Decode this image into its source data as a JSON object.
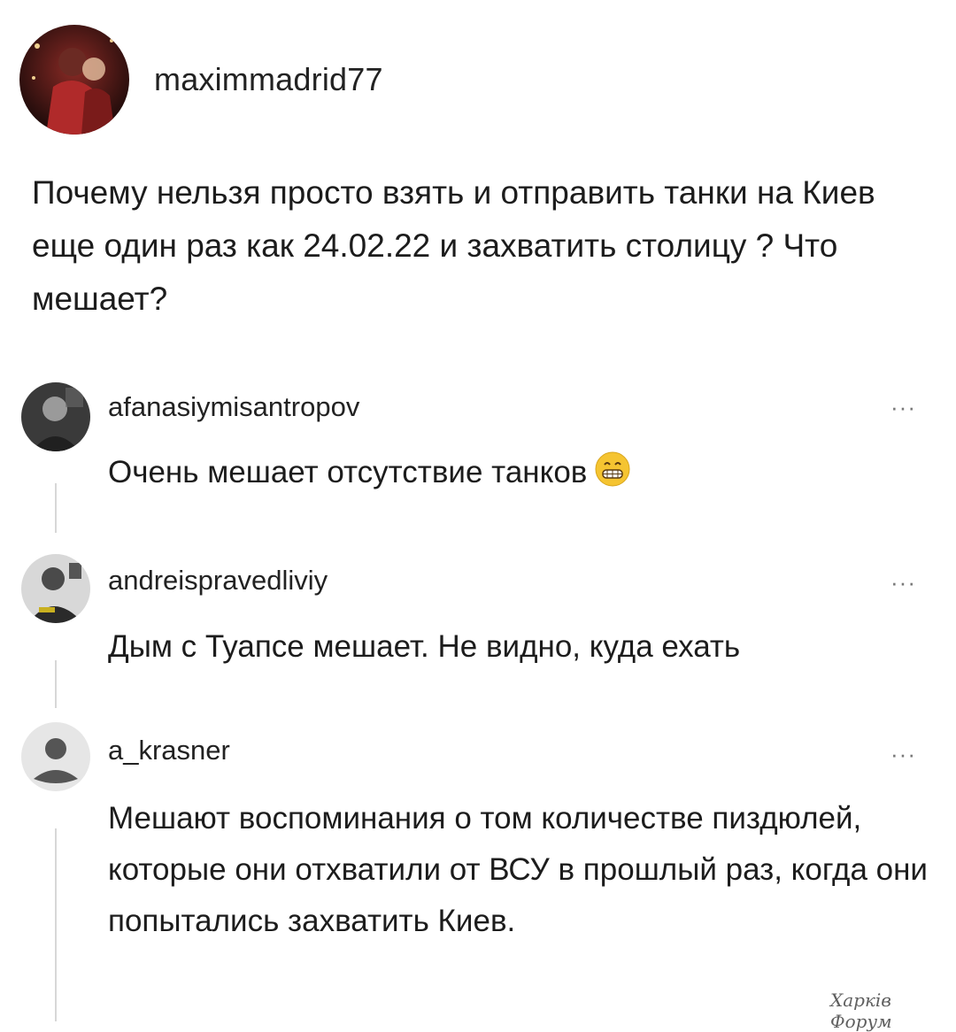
{
  "post": {
    "username": "maximmadrid77",
    "text": "Почему нельзя просто взять и отправить танки на Киев еще один раз как 24.02.22 и захватить столицу ? Что мешает?"
  },
  "comments": [
    {
      "username": "afanasiymisantropov",
      "text": "Очень мешает отсутствие танков",
      "emoji": "grinning-face-emoji",
      "more": "···"
    },
    {
      "username": "andreispravedliviy",
      "text": "Дым с Туапсе мешает. Не видно, куда ехать",
      "more": "···"
    },
    {
      "username": "a_krasner",
      "text": "Мешают воспоминания о том количестве пиздюлей, которые они отхватили от ВСУ в прошлый раз, когда они попытались захватить Киев.",
      "more": "···"
    }
  ],
  "watermark": "Харків Форум"
}
